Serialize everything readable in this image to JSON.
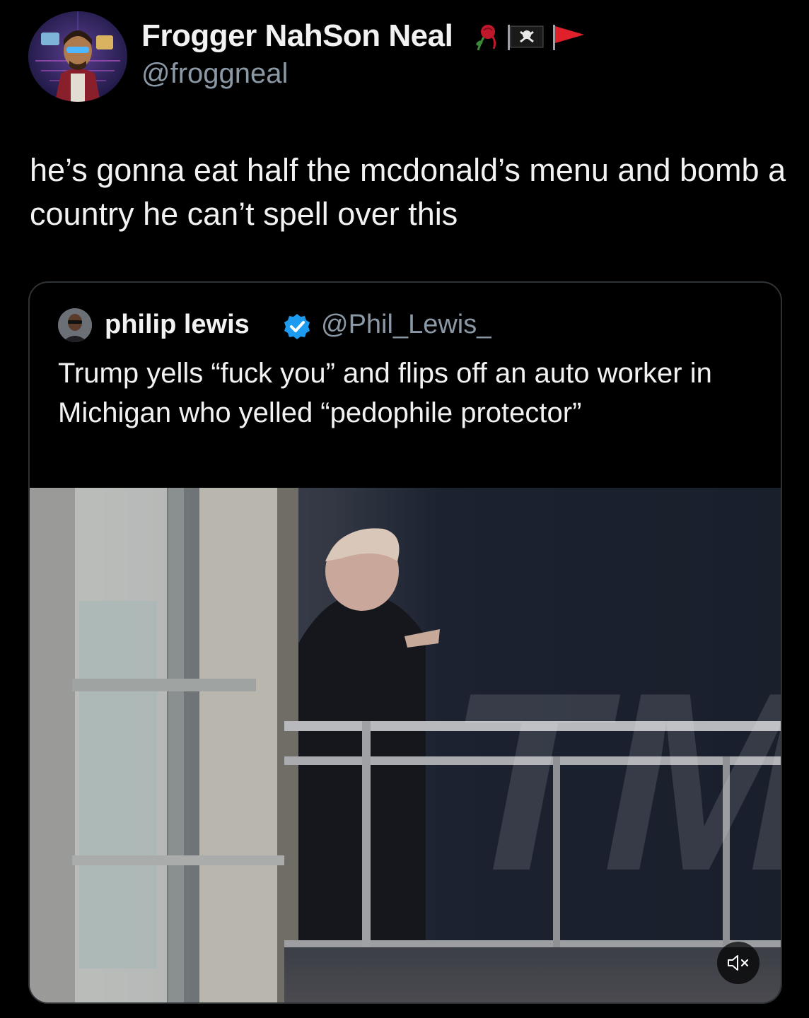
{
  "tweet": {
    "author_name": "Frogger NahSon Neal",
    "author_handle": "@froggneal",
    "name_emojis": [
      "rose-icon",
      "pirate-flag-icon",
      "red-flag-icon"
    ],
    "text": "he’s gonna eat half the mcdonald’s menu and bomb a country he can’t spell over this"
  },
  "quoted_tweet": {
    "author_name": "philip lewis",
    "verified": true,
    "author_handle": "@Phil_Lewis_",
    "text": "Trump yells “fuck you” and flips off an auto worker in Michigan who yelled “pedophile protector”",
    "media": {
      "type": "video",
      "watermark": "TMZ",
      "controls": [
        "mute-icon"
      ]
    }
  },
  "colors": {
    "background": "#000000",
    "primary_text": "#f2f2f2",
    "secondary_text": "#8b98a5",
    "verified_blue": "#1d9bf0",
    "border": "#2f3336"
  }
}
